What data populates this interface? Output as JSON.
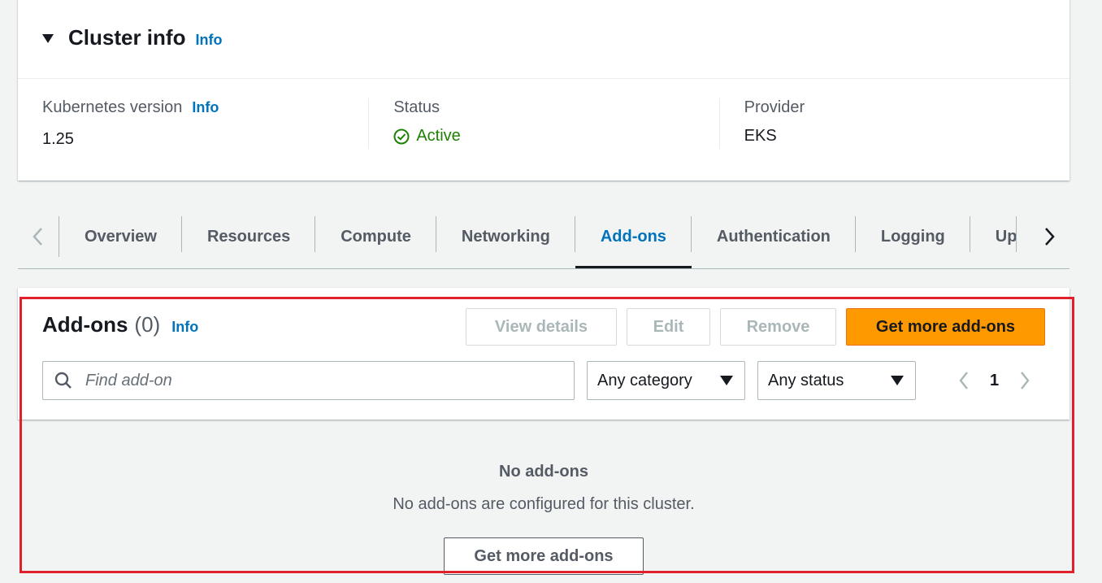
{
  "cluster_info": {
    "title": "Cluster info",
    "info_label": "Info",
    "kubernetes_version": {
      "label": "Kubernetes version",
      "info_label": "Info",
      "value": "1.25"
    },
    "status": {
      "label": "Status",
      "value": "Active",
      "icon": "check-circle-icon",
      "color": "#1d8102"
    },
    "provider": {
      "label": "Provider",
      "value": "EKS"
    }
  },
  "tabs": {
    "items": [
      {
        "label": "Overview"
      },
      {
        "label": "Resources"
      },
      {
        "label": "Compute"
      },
      {
        "label": "Networking"
      },
      {
        "label": "Add-ons"
      },
      {
        "label": "Authentication"
      },
      {
        "label": "Logging"
      },
      {
        "label": "Up"
      }
    ],
    "active": "Add-ons"
  },
  "addons": {
    "title": "Add-ons",
    "count": "(0)",
    "info_label": "Info",
    "buttons": {
      "view_details": "View details",
      "edit": "Edit",
      "remove": "Remove",
      "get_more": "Get more add-ons"
    },
    "search": {
      "placeholder": "Find add-on",
      "value": ""
    },
    "category_select": {
      "value": "Any category"
    },
    "status_select": {
      "value": "Any status"
    },
    "pagination": {
      "current_page": "1"
    },
    "empty_state": {
      "title": "No add-ons",
      "description": "No add-ons are configured for this cluster.",
      "button": "Get more add-ons"
    }
  },
  "colors": {
    "accent": "#0073bb",
    "primary_button": "#ff9900",
    "highlight_border": "#e0202a",
    "status_active": "#1d8102"
  }
}
